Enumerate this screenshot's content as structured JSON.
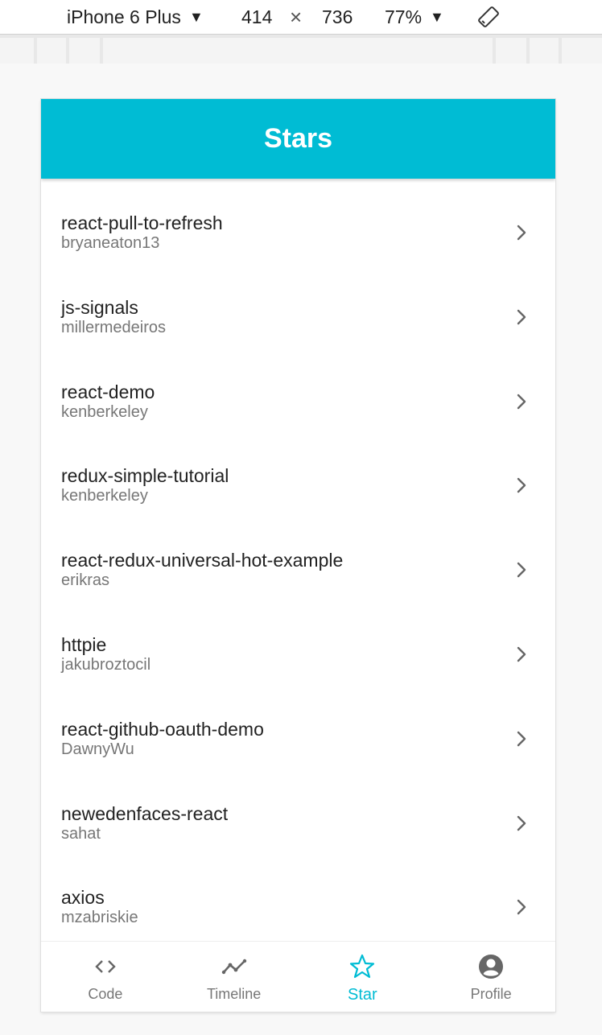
{
  "devtools": {
    "device": "iPhone 6 Plus",
    "width": "414",
    "times": "×",
    "height": "736",
    "zoom": "77%",
    "caret": "▼"
  },
  "app": {
    "title": "Stars",
    "accent": "#00bcd4",
    "items": [
      {
        "name": "react-pull-to-refresh",
        "owner": "bryaneaton13"
      },
      {
        "name": "js-signals",
        "owner": "millermedeiros"
      },
      {
        "name": "react-demo",
        "owner": "kenberkeley"
      },
      {
        "name": "redux-simple-tutorial",
        "owner": "kenberkeley"
      },
      {
        "name": "react-redux-universal-hot-example",
        "owner": "erikras"
      },
      {
        "name": "httpie",
        "owner": "jakubroztocil"
      },
      {
        "name": "react-github-oauth-demo",
        "owner": "DawnyWu"
      },
      {
        "name": "newedenfaces-react",
        "owner": "sahat"
      },
      {
        "name": "axios",
        "owner": "mzabriskie"
      }
    ],
    "nav": [
      {
        "label": "Code",
        "icon": "code-icon"
      },
      {
        "label": "Timeline",
        "icon": "timeline-icon"
      },
      {
        "label": "Star",
        "icon": "star-icon",
        "active": true
      },
      {
        "label": "Profile",
        "icon": "profile-icon"
      }
    ]
  }
}
